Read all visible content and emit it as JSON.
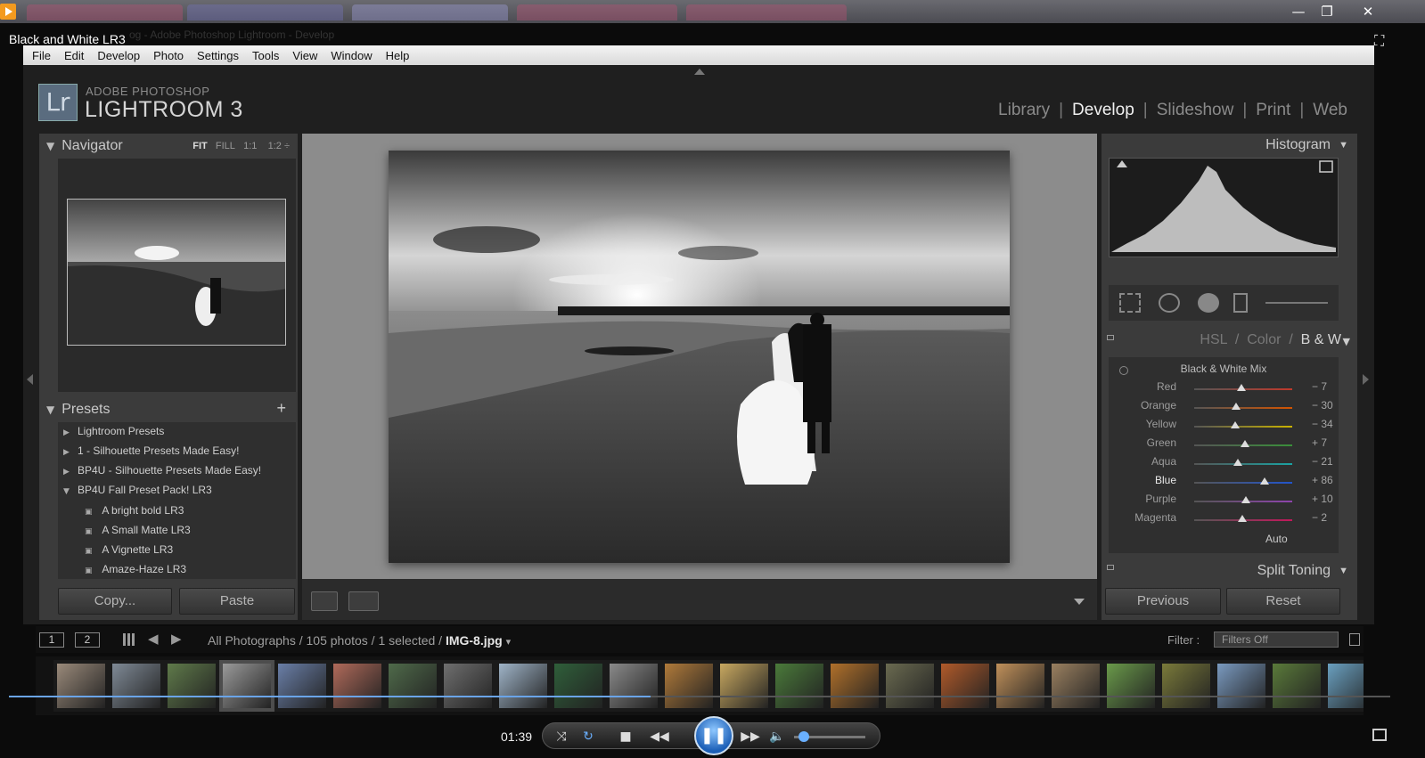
{
  "player": {
    "title": "Black and White LR3",
    "timecode": "01:39",
    "window_title": "og - Adobe Photoshop Lightroom - Develop"
  },
  "menubar": [
    "File",
    "Edit",
    "Develop",
    "Photo",
    "Settings",
    "Tools",
    "View",
    "Window",
    "Help"
  ],
  "branding": {
    "superline": "ADOBE PHOTOSHOP",
    "product": "LIGHTROOM 3",
    "icon": "Lr"
  },
  "modules": [
    {
      "label": "Library",
      "active": false
    },
    {
      "label": "Develop",
      "active": true
    },
    {
      "label": "Slideshow",
      "active": false
    },
    {
      "label": "Print",
      "active": false
    },
    {
      "label": "Web",
      "active": false
    }
  ],
  "navigator": {
    "title": "Navigator",
    "opt_fit": "FIT",
    "opt_fill": "FILL",
    "opt_11": "1:1",
    "opt_12": "1:2 ÷"
  },
  "presets": {
    "title": "Presets",
    "items": [
      {
        "label": "Lightroom Presets",
        "icon": "triangle-right",
        "indent": 0
      },
      {
        "label": "1 - Silhouette Presets Made Easy!",
        "icon": "triangle-right",
        "indent": 0
      },
      {
        "label": "BP4U - Silhouette Presets Made Easy!",
        "icon": "triangle-right",
        "indent": 0
      },
      {
        "label": "BP4U Fall Preset Pack! LR3",
        "icon": "triangle-down",
        "indent": 0
      },
      {
        "label": "A bright bold LR3",
        "icon": "preset-icon",
        "indent": 1
      },
      {
        "label": "A Small Matte LR3",
        "icon": "preset-icon",
        "indent": 1
      },
      {
        "label": "A Vignette LR3",
        "icon": "preset-icon",
        "indent": 1
      },
      {
        "label": "Amaze-Haze LR3",
        "icon": "preset-icon",
        "indent": 1
      }
    ],
    "copy_label": "Copy...",
    "paste_label": "Paste"
  },
  "right": {
    "histogram_title": "Histogram",
    "hsl_tab": "HSL",
    "color_tab": "Color",
    "bw_tab": "B & W",
    "bw_title": "Black & White Mix",
    "sliders": [
      {
        "label": "Red",
        "value": "− 7",
        "pos": -7,
        "strong": false
      },
      {
        "label": "Orange",
        "value": "− 30",
        "pos": -30,
        "strong": false
      },
      {
        "label": "Yellow",
        "value": "− 34",
        "pos": -34,
        "strong": false
      },
      {
        "label": "Green",
        "value": "+ 7",
        "pos": 7,
        "strong": false
      },
      {
        "label": "Aqua",
        "value": "− 21",
        "pos": -21,
        "strong": false
      },
      {
        "label": "Blue",
        "value": "+ 86",
        "pos": 86,
        "strong": true
      },
      {
        "label": "Purple",
        "value": "+ 10",
        "pos": 10,
        "strong": false
      },
      {
        "label": "Magenta",
        "value": "− 2",
        "pos": -2,
        "strong": false
      }
    ],
    "auto_label": "Auto",
    "split_toning": "Split Toning",
    "previous_label": "Previous",
    "reset_label": "Reset"
  },
  "filmbar": {
    "page1": "1",
    "page2": "2",
    "path_prefix": "All Photographs / 105 photos / 1 selected /",
    "filename": "IMG-8.jpg",
    "filter_label": "Filter :",
    "filter_value": "Filters Off"
  },
  "colors": {
    "accent_blue": "#6aa4e8",
    "lr_panel": "#3b3b3b",
    "photo_bg": "#8c8c8c"
  }
}
